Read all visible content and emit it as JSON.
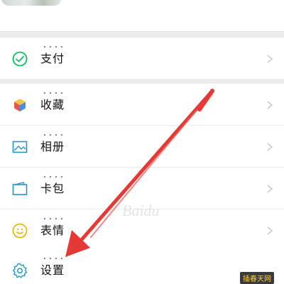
{
  "menu": {
    "pay": {
      "label": "支付",
      "icon": "wechat-pay-icon"
    },
    "favorites": {
      "label": "收藏",
      "icon": "cube-icon"
    },
    "album": {
      "label": "相册",
      "icon": "image-icon"
    },
    "cards": {
      "label": "卡包",
      "icon": "wallet-icon"
    },
    "stickers": {
      "label": "表情",
      "icon": "smiley-icon"
    },
    "settings": {
      "label": "设置",
      "icon": "gear-icon"
    }
  },
  "annotation": {
    "arrow_color": "#e53935"
  },
  "watermark": {
    "text": "插春天网",
    "faint_text": "Baidu"
  },
  "colors": {
    "pay_green": "#07c160",
    "blue_icon": "#2196c9",
    "yellow_icon": "#f0b400",
    "chevron": "#c7c7c7"
  }
}
